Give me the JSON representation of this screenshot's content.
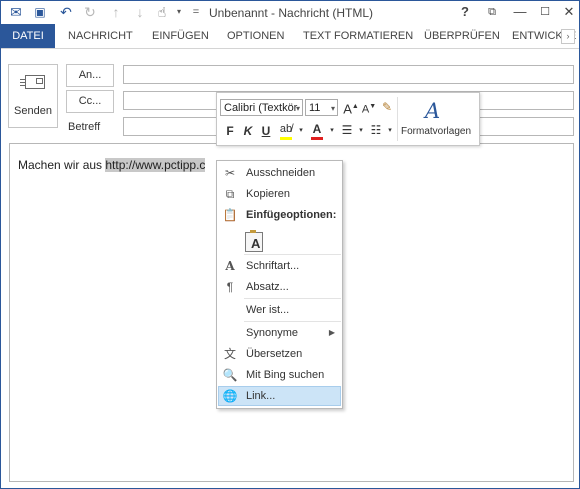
{
  "window": {
    "title": "Unbenannt - Nachricht (HTML)",
    "controls": {
      "help": "?",
      "restore": "⧉",
      "minimize": "—",
      "close": "✕"
    }
  },
  "quick_access": [
    {
      "name": "outlook-logo-icon",
      "glyph": "✉"
    },
    {
      "name": "save-icon",
      "glyph": "💾"
    },
    {
      "name": "undo-icon",
      "glyph": "↶"
    },
    {
      "name": "redo-icon",
      "glyph": "↻"
    },
    {
      "name": "arrow-up-icon",
      "glyph": "↑"
    },
    {
      "name": "arrow-down-icon",
      "glyph": "↓"
    },
    {
      "name": "touch-mode-icon",
      "glyph": "☝"
    },
    {
      "name": "customize-icon",
      "glyph": "="
    }
  ],
  "ribbon": {
    "tabs": [
      "DATEI",
      "NACHRICHT",
      "EINFÜGEN",
      "OPTIONEN",
      "TEXT FORMATIEREN",
      "ÜBERPRÜFEN",
      "ENTWICKLE"
    ],
    "more_glyph": "›"
  },
  "compose": {
    "send_label": "Senden",
    "to_label": "An...",
    "cc_label": "Cc...",
    "subject_label": "Betreff",
    "to_value": "",
    "cc_value": "",
    "subject_value": ""
  },
  "message": {
    "text_before": "Machen wir aus ",
    "selected_text": "http://www.pctipp.c"
  },
  "mini_toolbar": {
    "font_name": "Calibri (Textkör",
    "font_size": "11",
    "grow_font": "A",
    "shrink_font": "A",
    "bold": "F",
    "italic": "K",
    "underline": "U",
    "font_color": "A",
    "styles_label": "Formatvorlagen"
  },
  "context_menu": {
    "cut": "Ausschneiden",
    "copy": "Kopieren",
    "paste_options": "Einfügeoptionen:",
    "paste_keep": "A",
    "font": "Schriftart...",
    "paragraph": "Absatz...",
    "who_is": "Wer ist...",
    "synonyms": "Synonyme",
    "translate": "Übersetzen",
    "bing": "Mit Bing suchen",
    "link": "Link..."
  },
  "colors": {
    "accent": "#2b579a",
    "highlight": "#cce4f7",
    "font_color_bar": "#e02020",
    "highlight_color_bar": "#ffff00"
  }
}
